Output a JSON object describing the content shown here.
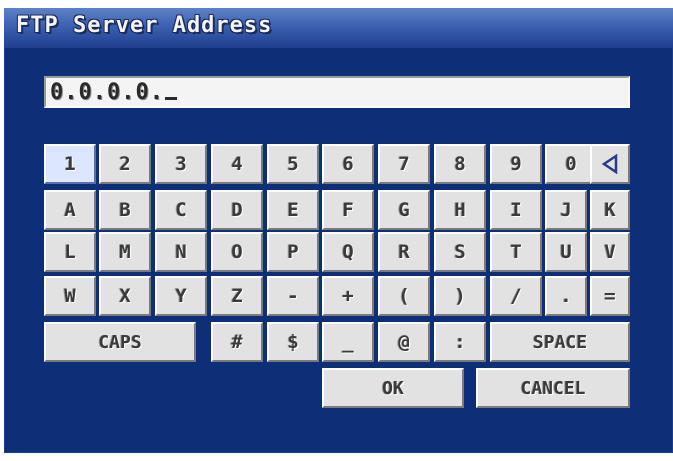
{
  "window": {
    "title": "FTP Server Address"
  },
  "address": {
    "value": "0.0.0.0."
  },
  "keyboard": {
    "row1": [
      "1",
      "2",
      "3",
      "4",
      "5",
      "6",
      "7",
      "8",
      "9",
      "0"
    ],
    "backspace_icon": "backspace-triangle-icon",
    "row2": [
      "A",
      "B",
      "C",
      "D",
      "E",
      "F",
      "G",
      "H",
      "I",
      "J",
      "K"
    ],
    "row3": [
      "L",
      "M",
      "N",
      "O",
      "P",
      "Q",
      "R",
      "S",
      "T",
      "U",
      "V"
    ],
    "row4": [
      "W",
      "X",
      "Y",
      "Z",
      "-",
      "+",
      "(",
      ")",
      "/",
      ".",
      "="
    ],
    "caps_label": "CAPS",
    "row5_keys": [
      "#",
      "$",
      "_",
      "@",
      ":"
    ],
    "space_label": "SPACE",
    "ok_label": "OK",
    "cancel_label": "CANCEL"
  },
  "colors": {
    "panel": "#0d2f78",
    "key_face": "#e2e2e2",
    "selected_key": "#dce6ff"
  }
}
